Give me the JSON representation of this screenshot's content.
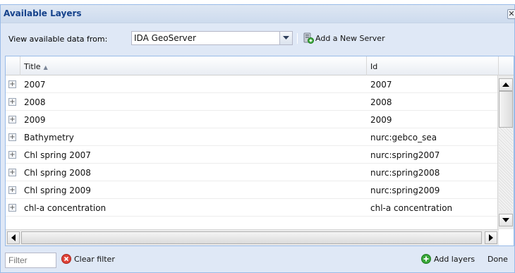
{
  "window": {
    "title": "Available Layers",
    "close_glyph": "✕"
  },
  "toolbar": {
    "source_label": "View available data from:",
    "server_value": "IDA GeoServer",
    "add_server_label": "Add a New Server"
  },
  "grid": {
    "columns": {
      "title": "Title",
      "id": "Id"
    },
    "rows": [
      {
        "title": "2007",
        "id": "2007"
      },
      {
        "title": "2008",
        "id": "2008"
      },
      {
        "title": "2009",
        "id": "2009"
      },
      {
        "title": "Bathymetry",
        "id": "nurc:gebco_sea"
      },
      {
        "title": "Chl spring 2007",
        "id": "nurc:spring2007"
      },
      {
        "title": "Chl spring 2008",
        "id": "nurc:spring2008"
      },
      {
        "title": "Chl spring 2009",
        "id": "nurc:spring2009"
      },
      {
        "title": "chl-a concentration",
        "id": "chl-a concentration"
      }
    ],
    "expander_glyph": "+"
  },
  "bottombar": {
    "filter_placeholder": "Filter",
    "clear_filter_label": "Clear filter",
    "add_layers_label": "Add layers",
    "done_label": "Done"
  },
  "colors": {
    "title_text": "#15428b",
    "panel_bg": "#dfe8f6",
    "border": "#99bbe8",
    "clear_icon": "#e0443a",
    "add_icon": "#3aa83a"
  },
  "icons": [
    "close-icon",
    "chevron-down-icon",
    "server-add-icon",
    "expand-icon",
    "clear-icon",
    "add-icon"
  ]
}
